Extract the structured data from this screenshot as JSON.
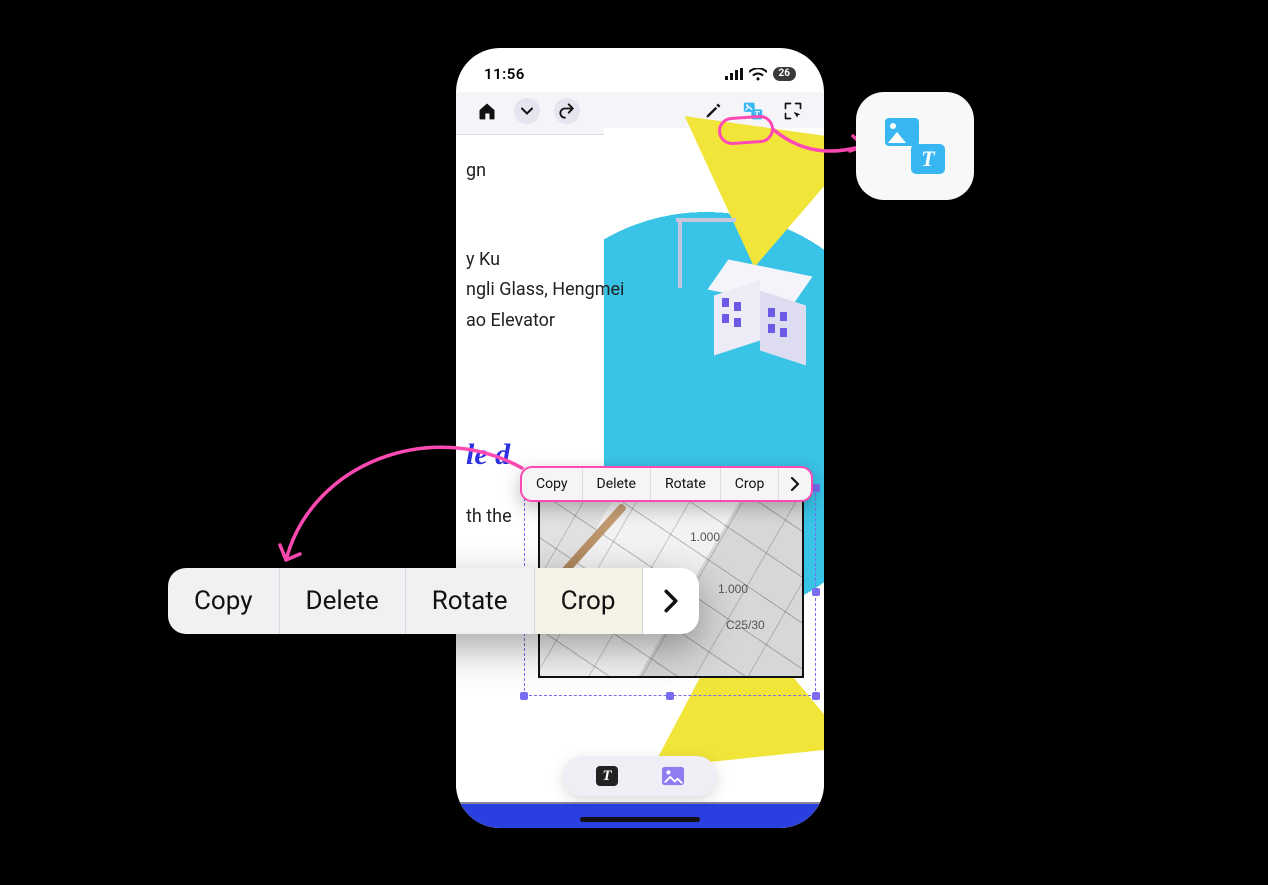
{
  "status": {
    "time": "11:56",
    "battery": "26"
  },
  "doc": {
    "line1": "gn",
    "line2": "y Ku",
    "line3": "ngli Glass, Hengmei",
    "line4": "ao Elevator",
    "heading_fragment": "le d",
    "para1": "th the",
    "image_numbers": [
      "1.000",
      "1.000",
      "C25/30"
    ]
  },
  "context_menu": {
    "items": [
      "Copy",
      "Delete",
      "Rotate",
      "Crop"
    ]
  },
  "toggle": {
    "text_label": "T"
  },
  "colors": {
    "annotation": "#ff49b3",
    "icon_tool": "#38b6f2",
    "accent_purple": "#7a6cf0"
  }
}
